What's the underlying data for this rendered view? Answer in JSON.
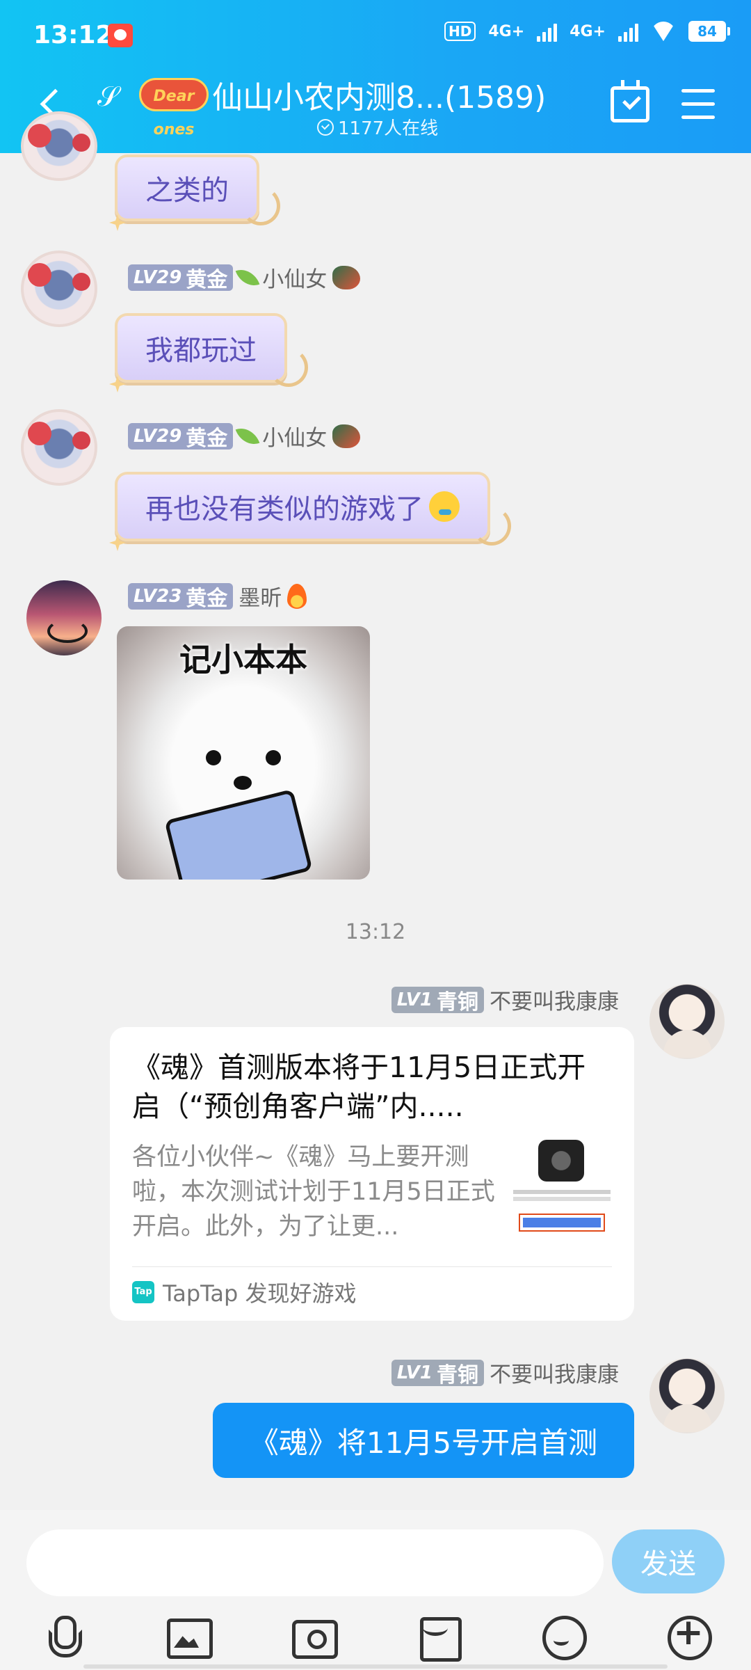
{
  "status_bar": {
    "time": "13:12",
    "hd": "HD",
    "net1": "4G+",
    "net2": "4G+",
    "battery": "84"
  },
  "header": {
    "group_logo_text": "Dear ones",
    "title": "仙山小农内测8...(1589)",
    "online": "1177人在线"
  },
  "messages": [
    {
      "bubble_text": "之类的"
    },
    {
      "level": "LV29",
      "rank": "黄金",
      "name": "小仙女",
      "bubble_text": "我都玩过"
    },
    {
      "level": "LV29",
      "rank": "黄金",
      "name": "小仙女",
      "bubble_text": "再也没有类似的游戏了"
    },
    {
      "level": "LV23",
      "rank": "黄金",
      "name": "墨昕",
      "sticker_text": "记小本本"
    }
  ],
  "timestamp": "13:12",
  "card_message": {
    "level": "LV1",
    "rank": "青铜",
    "name": "不要叫我康康",
    "title": "《魂》首测版本将于11月5日正式开启（“预创角客户端”内.....",
    "description": "各位小伙伴~《魂》马上要开测啦，本次测试计划于11月5日正式开启。此外，为了让更...",
    "source_icon": "Tap",
    "source": "TapTap 发现好游戏"
  },
  "text_message": {
    "level": "LV1",
    "rank": "青铜",
    "name": "不要叫我康康",
    "text": "《魂》将11月5号开启首测"
  },
  "input": {
    "placeholder": "",
    "send_label": "发送"
  },
  "icons": [
    "back-icon",
    "ear-icon",
    "calendar-check-icon",
    "menu-icon",
    "mic-icon",
    "photo-icon",
    "camera-icon",
    "red-packet-icon",
    "emoji-icon",
    "plus-icon"
  ],
  "colors": {
    "header_start": "#12c4f3",
    "header_end": "#1a9cf6",
    "bubble_blue": "#1494f6",
    "send_button": "#8fd0f7"
  }
}
